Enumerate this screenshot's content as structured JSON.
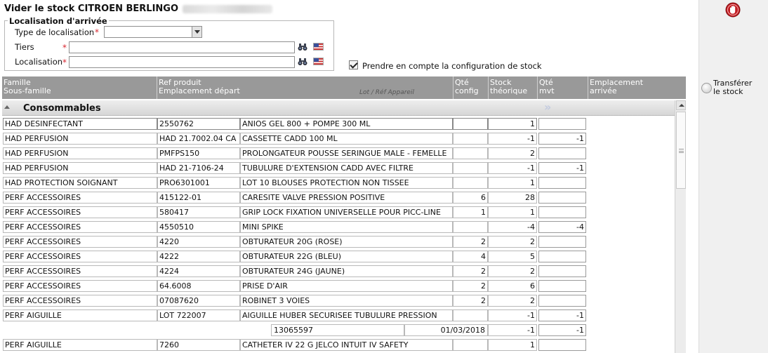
{
  "page": {
    "title": "Vider le stock CITROEN BERLINGO"
  },
  "location": {
    "legend": "Localisation d'arrivée",
    "type_label": "Type de localisation",
    "tiers_label": "Tiers",
    "localisation_label": "Localisation",
    "required_mark": "*"
  },
  "options": {
    "config_label": "Prendre en compte la configuration de stock",
    "config_checked": true
  },
  "sidebar": {
    "transfer_label_1": "Transférer",
    "transfer_label_2": "le stock"
  },
  "grid": {
    "headers": {
      "famille": "Famille",
      "sous_famille": "Sous-famille",
      "ref_produit": "Ref produit",
      "emplacement_depart": "Emplacement départ",
      "lot": "Lot / Réf Appareil",
      "qte_config_1": "Qté",
      "qte_config_2": "config",
      "stock_1": "Stock",
      "stock_2": "théorique",
      "mvt_1": "Qté",
      "mvt_2": "mvt",
      "emplacement_1": "Emplacement",
      "emplacement_2": "arrivée"
    },
    "group": "Consommables",
    "rows": [
      {
        "famille": "HAD DESINFECTANT",
        "ref": "2550762",
        "libelle": "ANIOS GEL 800 + POMPE 300 ML",
        "config": "",
        "stock": "1",
        "mvt": ""
      },
      {
        "famille": "HAD PERFUSION",
        "ref": "HAD 21.7002.04 CA",
        "libelle": "CASSETTE CADD 100 ML",
        "config": "",
        "stock": "-1",
        "mvt": "-1"
      },
      {
        "famille": "HAD PERFUSION",
        "ref": "PMFPS150",
        "libelle": "PROLONGATEUR POUSSE SERINGUE MALE - FEMELLE",
        "config": "",
        "stock": "2",
        "mvt": ""
      },
      {
        "famille": "HAD PERFUSION",
        "ref": "HAD 21-7106-24",
        "libelle": "TUBULURE D'EXTENSION CADD AVEC FILTRE",
        "config": "",
        "stock": "-1",
        "mvt": "-1"
      },
      {
        "famille": "HAD PROTECTION SOIGNANT",
        "ref": "PRO6301001",
        "libelle": "LOT 10 BLOUSES PROTECTION NON TISSEE",
        "config": "",
        "stock": "1",
        "mvt": ""
      },
      {
        "famille": "PERF ACCESSOIRES",
        "ref": "415122-01",
        "libelle": "CARESITE VALVE PRESSION POSITIVE",
        "config": "6",
        "stock": "28",
        "mvt": ""
      },
      {
        "famille": "PERF ACCESSOIRES",
        "ref": "580417",
        "libelle": "GRIP LOCK FIXATION UNIVERSELLE POUR PICC-LINE",
        "config": "1",
        "stock": "1",
        "mvt": ""
      },
      {
        "famille": "PERF ACCESSOIRES",
        "ref": "4550510",
        "libelle": "MINI SPIKE",
        "config": "",
        "stock": "-4",
        "mvt": "-4"
      },
      {
        "famille": "PERF ACCESSOIRES",
        "ref": "4220",
        "libelle": "OBTURATEUR 20G (ROSE)",
        "config": "2",
        "stock": "2",
        "mvt": ""
      },
      {
        "famille": "PERF ACCESSOIRES",
        "ref": "4222",
        "libelle": "OBTURATEUR 22G (BLEU)",
        "config": "4",
        "stock": "5",
        "mvt": ""
      },
      {
        "famille": "PERF ACCESSOIRES",
        "ref": "4224",
        "libelle": "OBTURATEUR 24G (JAUNE)",
        "config": "2",
        "stock": "2",
        "mvt": ""
      },
      {
        "famille": "PERF ACCESSOIRES",
        "ref": "64.6008",
        "libelle": "PRISE D'AIR",
        "config": "2",
        "stock": "6",
        "mvt": ""
      },
      {
        "famille": "PERF ACCESSOIRES",
        "ref": "07087620",
        "libelle": "ROBINET 3 VOIES",
        "config": "2",
        "stock": "2",
        "mvt": ""
      },
      {
        "famille": "PERF AIGUILLE",
        "ref": "LOT 722007",
        "libelle": "AIGUILLE HUBER SECURISEE TUBULURE PRESSION",
        "config": "",
        "stock": "-1",
        "mvt": "-1"
      }
    ],
    "lot_row": {
      "lot": "13065597",
      "date": "01/03/2018",
      "stock": "-1",
      "mvt": "-1"
    },
    "last_row": {
      "famille": "PERF AIGUILLE",
      "ref": "7260",
      "libelle": "CATHETER IV 22 G JELCO INTUIT IV SAFETY",
      "config": "",
      "stock": "1",
      "mvt": ""
    }
  }
}
